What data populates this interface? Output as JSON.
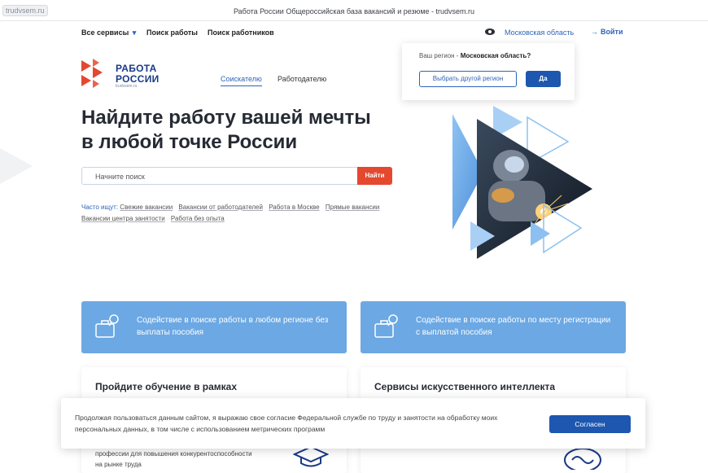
{
  "window": {
    "url_tag": "trudvsem.ru",
    "title": "Работа России Общероссийская база вакансий и резюме - trudvsem.ru"
  },
  "nav": {
    "services": "Все сервисы",
    "services_caret": "▾",
    "job_search": "Поиск работы",
    "worker_search": "Поиск работников",
    "region": "Московская область",
    "login": "Войти",
    "login_icon": "→"
  },
  "logo": {
    "line1": "РАБОТА",
    "line2": "РОССИИ",
    "line3": "trudvsem.ru"
  },
  "roles": {
    "seekers": "Соискателю",
    "employers": "Работодателю"
  },
  "region_popup": {
    "question_prefix": "Ваш регион - ",
    "question_region": "Московская область?",
    "other_button": "Выбрать другой регион",
    "yes_button": "Да"
  },
  "hero": {
    "title_line1": "Найдите работу вашей мечты",
    "title_line2": "в любой точке России",
    "search_placeholder": "Начните поиск",
    "search_button": "Найти",
    "frequent_label": "Часто ищут:",
    "frequent_tags": [
      "Свежие вакансии",
      "Вакансии от работодателей",
      "Работа в Москве",
      "Прямые вакансии",
      "Вакансии центра занятости",
      "Работа без опыта"
    ]
  },
  "cards_blue": [
    {
      "text": "Содействие в поиске работы в любом регионе без выплаты пособия"
    },
    {
      "text": "Содействие в поиске работы по месту регистрации с выплатой пособия"
    }
  ],
  "cards_white": [
    {
      "title": "Пройдите обучение в рамках",
      "sub": "профессии для повышения конкурентоспособности на рынке труда"
    },
    {
      "title": "Сервисы искусственного интеллекта"
    }
  ],
  "cookie": {
    "text": "Продолжая пользоваться данным сайтом, я выражаю свое согласие Федеральной службе по труду и занятости на обработку моих персональных данных, в том числе с использованием метрических программ",
    "accept": "Согласен"
  },
  "colors": {
    "brand_blue": "#1d57b0",
    "link_blue": "#2e64b8",
    "accent_red": "#e4482f",
    "card_blue": "#6ba8e4"
  }
}
